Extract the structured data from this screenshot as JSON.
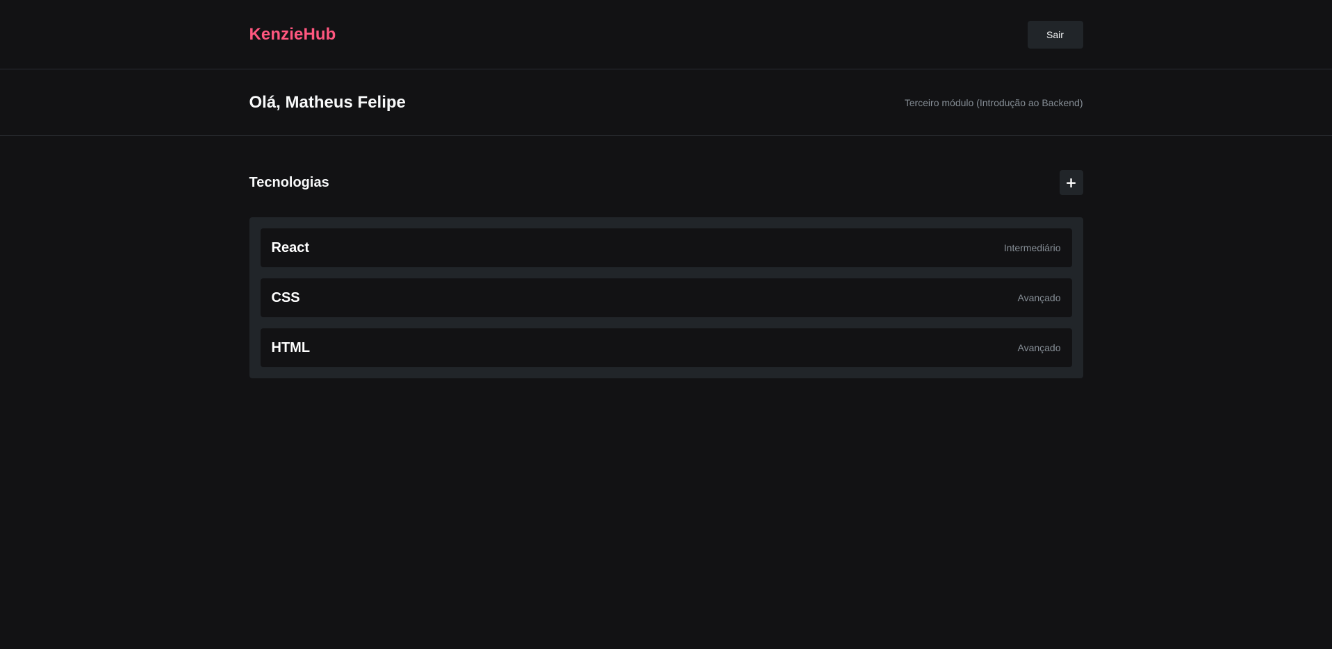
{
  "header": {
    "logo": "KenzieHub",
    "logout_label": "Sair"
  },
  "user": {
    "greeting": "Olá, Matheus Felipe",
    "module": "Terceiro módulo (Introdução ao Backend)"
  },
  "technologies": {
    "title": "Tecnologias",
    "add_label": "+",
    "items": [
      {
        "name": "React",
        "status": "Intermediário"
      },
      {
        "name": "CSS",
        "status": "Avançado"
      },
      {
        "name": "HTML",
        "status": "Avançado"
      }
    ]
  },
  "colors": {
    "background": "#121214",
    "surface": "#212529",
    "brand": "#FF577F",
    "text": "#F8F9FA",
    "muted": "#868E96"
  }
}
